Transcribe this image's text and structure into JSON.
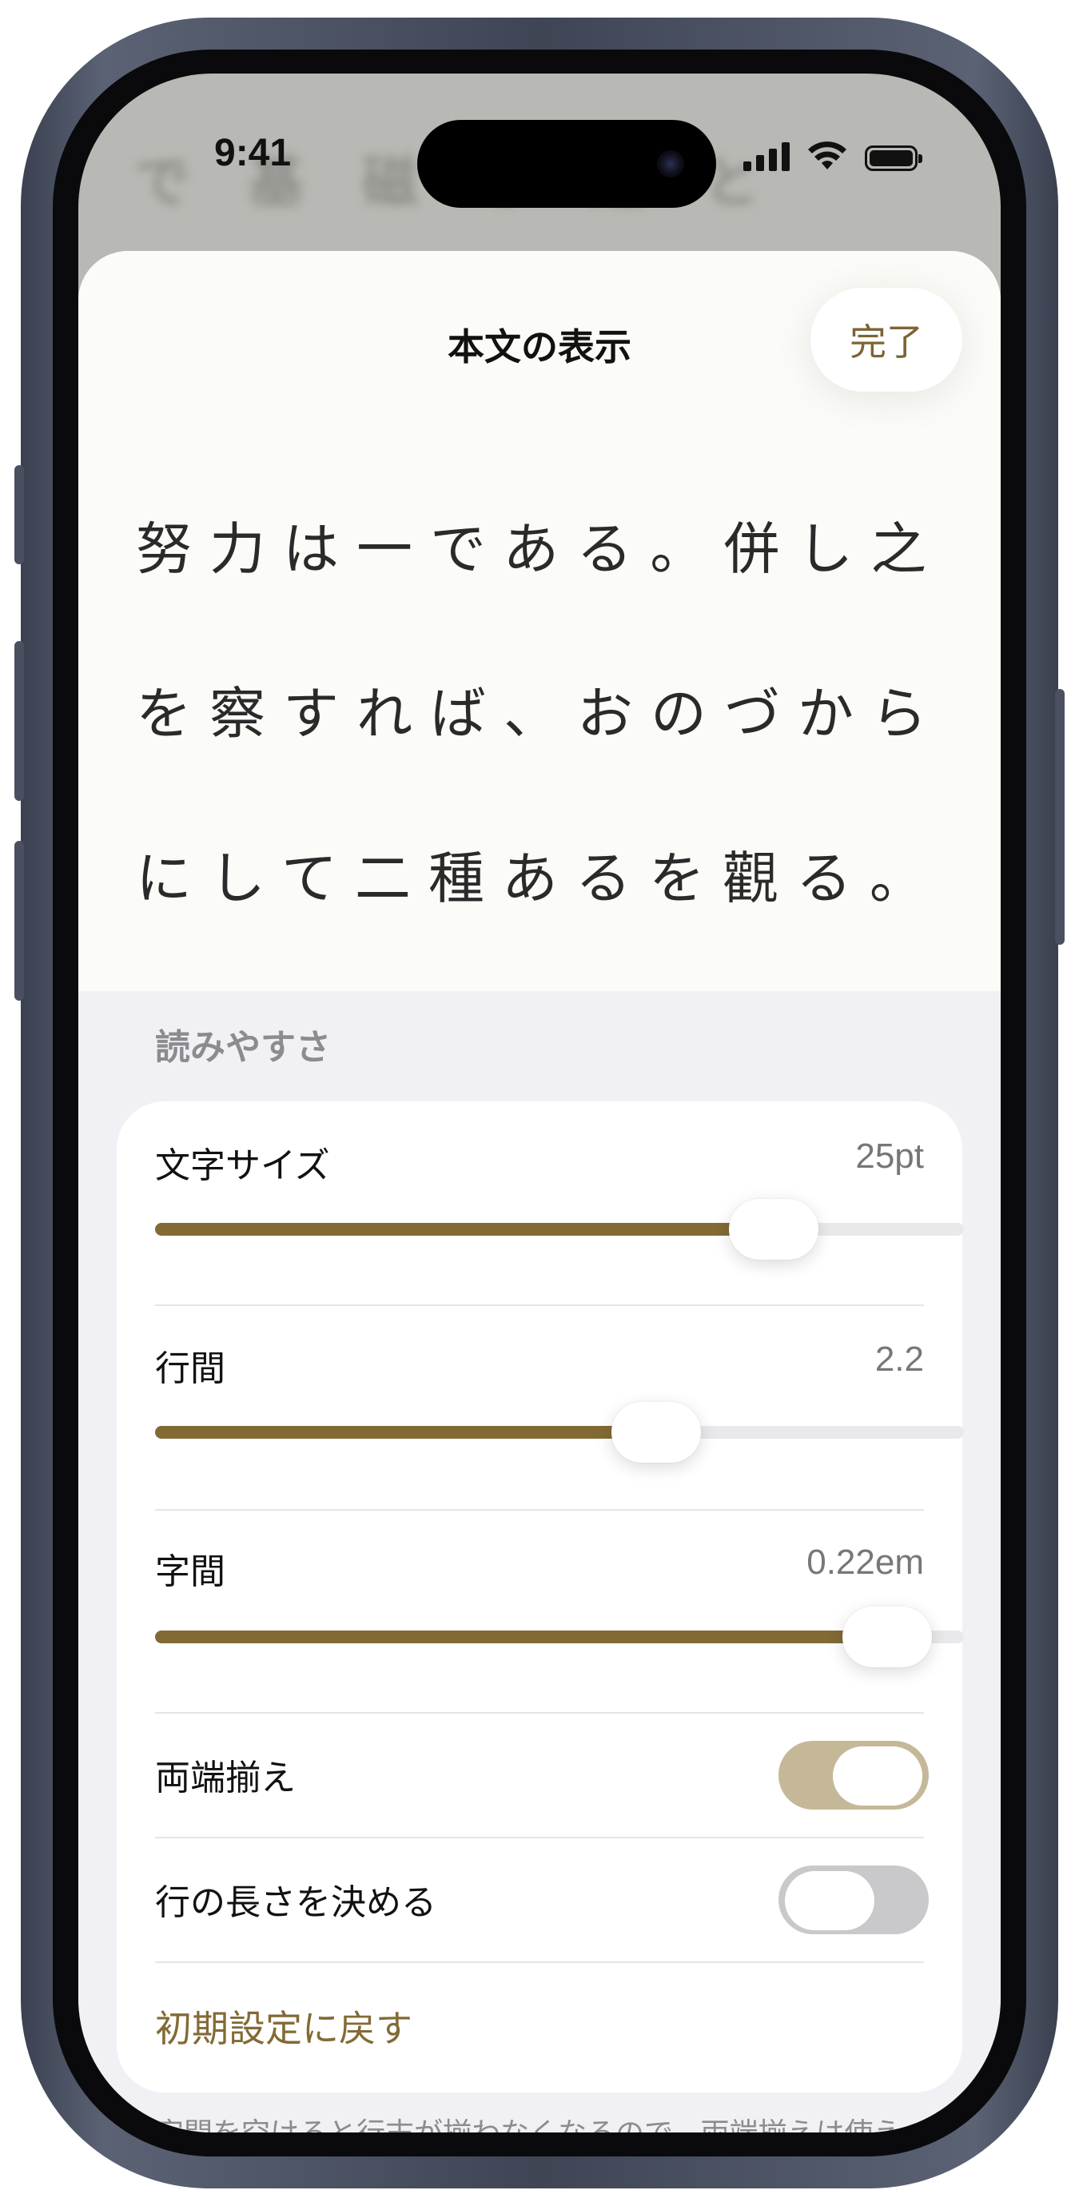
{
  "status_bar": {
    "time": "9:41"
  },
  "background": {
    "blurred_text": "で 基 磁 る 是 と"
  },
  "sheet": {
    "title": "本文の表示",
    "done_label": "完了"
  },
  "preview": {
    "lines": [
      "努力は一である。併し之",
      "を察すれば、おのづから",
      "にして二種あるを觀る。"
    ]
  },
  "readability": {
    "section_label": "読みやすさ",
    "font_size": {
      "label": "文字サイズ",
      "value": "25pt",
      "fraction": 0.765
    },
    "line_spacing": {
      "label": "行間",
      "value": "2.2",
      "fraction": 0.62
    },
    "letter_spacing": {
      "label": "字間",
      "value": "0.22em",
      "fraction": 0.905
    },
    "justify": {
      "label": "両端揃え",
      "on": true
    },
    "line_length": {
      "label": "行の長さを決める",
      "on": false
    },
    "reset_label": "初期設定に戻す"
  },
  "footnote": "字間を空けると行末が揃わなくなるので、両端揃えは使えません。",
  "colors": {
    "accent": "#836a35",
    "toggle_on": "#c4b898",
    "toggle_off": "#c9c9cb"
  }
}
